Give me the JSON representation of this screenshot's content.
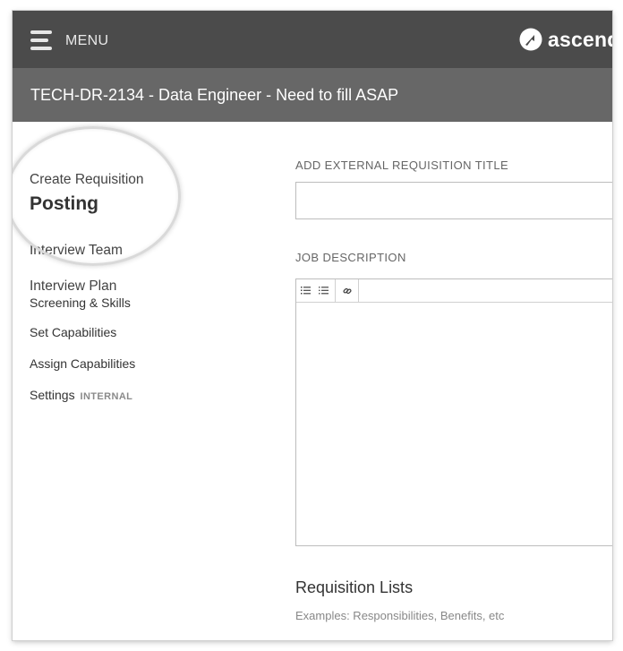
{
  "header": {
    "menu_label": "MENU",
    "logo_text": "ascend",
    "logo_icon": "ascend-arrow-logo-icon"
  },
  "requisition": {
    "title": "TECH-DR-2134 - Data Engineer - Need to fill ASAP"
  },
  "sidebar": {
    "items": [
      {
        "label": "Create Requisition"
      },
      {
        "label": "Posting"
      },
      {
        "label": "Interview Team"
      },
      {
        "label": "Interview Plan"
      },
      {
        "label": "Screening & Skills"
      },
      {
        "label": "Set Capabilities"
      },
      {
        "label": "Assign Capabilities"
      },
      {
        "label": "Settings",
        "badge": "INTERNAL"
      }
    ],
    "active_item": "Posting"
  },
  "form": {
    "external_title_label": "ADD EXTERNAL REQUISITION TITLE",
    "external_title_value": "",
    "job_description_label": "JOB DESCRIPTION",
    "job_description_value": "",
    "toolbar_icons": [
      "ordered-list-icon",
      "unordered-list-icon",
      "link-icon"
    ],
    "lists_title": "Requisition Lists",
    "lists_hint": "Examples: Responsibilities, Benefits, etc"
  },
  "colors": {
    "topbar_bg": "#4b4b4b",
    "titlebar_bg": "#676767",
    "text_dark": "#333333",
    "text_muted": "#666666"
  }
}
